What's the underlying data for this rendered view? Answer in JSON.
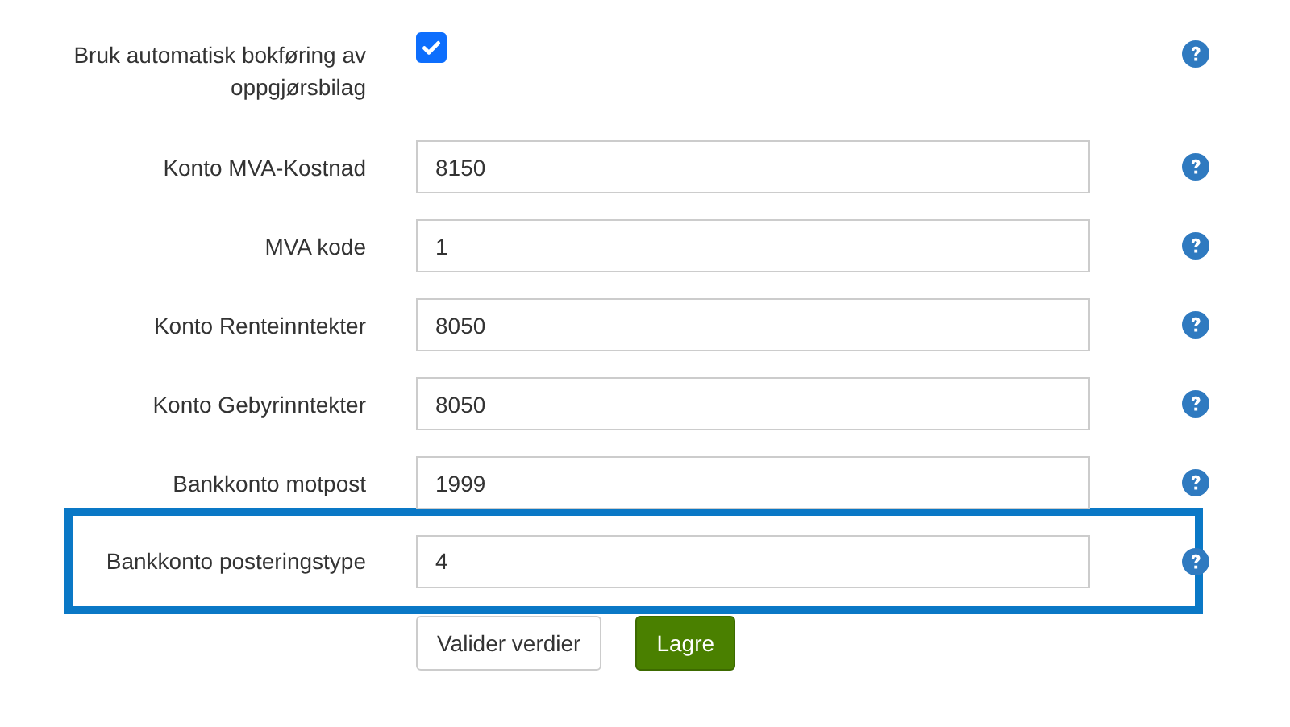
{
  "fields": [
    {
      "kind": "checkbox",
      "label": "Bruk automatisk bokføring av oppgjørsbilag",
      "checked": true,
      "highlighted": false
    },
    {
      "kind": "input",
      "label": "Konto MVA-Kostnad",
      "value": "8150",
      "highlighted": false
    },
    {
      "kind": "input",
      "label": "MVA kode",
      "value": "1",
      "highlighted": false
    },
    {
      "kind": "input",
      "label": "Konto Renteinntekter",
      "value": "8050",
      "highlighted": false
    },
    {
      "kind": "input",
      "label": "Konto Gebyrinntekter",
      "value": "8050",
      "highlighted": false
    },
    {
      "kind": "input",
      "label": "Bankkonto motpost",
      "value": "1999",
      "highlighted": false
    },
    {
      "kind": "input",
      "label": "Bankkonto posteringstype",
      "value": "4",
      "highlighted": true
    }
  ],
  "buttons": [
    {
      "kind": "secondary",
      "label": "Valider verdier"
    },
    {
      "kind": "primary",
      "label": "Lagre"
    }
  ]
}
